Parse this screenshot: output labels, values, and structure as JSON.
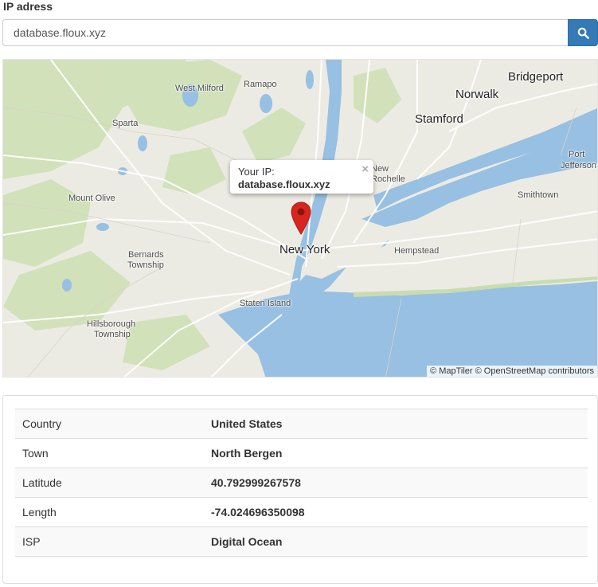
{
  "form": {
    "label": "IP adress",
    "input_value": "database.floux.xyz",
    "search_icon": "search-icon"
  },
  "map": {
    "places": {
      "west_milford": "West Milford",
      "ramapo": "Ramapo",
      "bridgeport": "Bridgeport",
      "norwalk": "Norwalk",
      "stamford": "Stamford",
      "sparta": "Sparta",
      "port_jefferson_1": "Port",
      "port_jefferson_2": "Jefferson",
      "new_rochelle_1": "New",
      "new_rochelle_2": "Rochelle",
      "smithtown": "Smithtown",
      "mount_olive": "Mount Olive",
      "bernards_1": "Bernards",
      "bernards_2": "Township",
      "new_york": "New York",
      "hempstead": "Hempstead",
      "staten_island": "Staten Island",
      "hillsborough_1": "Hillsborough",
      "hillsborough_2": "Township"
    },
    "popup": {
      "title": "Your IP:",
      "value": "database.floux.xyz",
      "close": "×"
    },
    "attribution": "© MapTiler © OpenStreetMap contributors",
    "colors": {
      "water": "#97c0e2",
      "land": "#ecebe3",
      "park": "#cfe0b5",
      "marker": "#d7261e"
    }
  },
  "info": {
    "rows": [
      {
        "key": "Country",
        "value": "United States"
      },
      {
        "key": "Town",
        "value": "North Bergen"
      },
      {
        "key": "Latitude",
        "value": "40.792999267578"
      },
      {
        "key": "Length",
        "value": "-74.024696350098"
      },
      {
        "key": "ISP",
        "value": "Digital Ocean"
      }
    ]
  }
}
